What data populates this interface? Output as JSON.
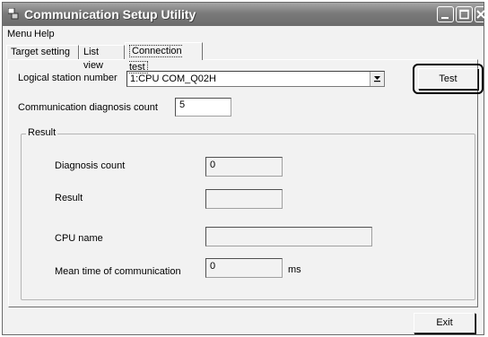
{
  "window": {
    "title": "Communication Setup Utility"
  },
  "menu": {
    "items": [
      "Menu",
      "Help"
    ]
  },
  "tabs": [
    "Target setting",
    "List view",
    "Connection test"
  ],
  "connection_test": {
    "logical_station_label": "Logical station number",
    "logical_station_value": "1:CPU COM_Q02H",
    "diagnosis_count_label": "Communication diagnosis count",
    "diagnosis_count_value": "5",
    "test_button": "Test"
  },
  "result": {
    "group_title": "Result",
    "diagnosis_count_label": "Diagnosis count",
    "diagnosis_count_value": "0",
    "result_label": "Result",
    "result_value": "",
    "cpu_name_label": "CPU name",
    "cpu_name_value": "",
    "mean_time_label": "Mean time of communication",
    "mean_time_value": "0",
    "mean_time_unit": "ms"
  },
  "footer": {
    "exit_button": "Exit"
  }
}
